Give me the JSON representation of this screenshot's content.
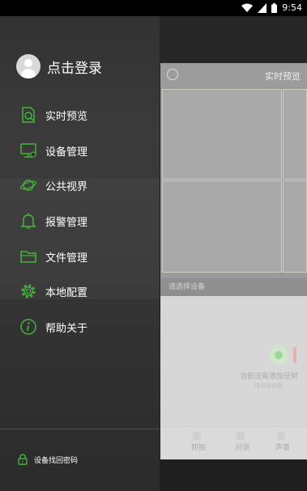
{
  "status_bar": {
    "time": "9:54",
    "icons": [
      "wifi-icon",
      "signal-icon",
      "battery-icon"
    ]
  },
  "drawer": {
    "login_label": "点击登录",
    "avatar_icon": "user-avatar-icon",
    "accent": "#46b33a",
    "menu": [
      {
        "label": "实时预览",
        "icon": "live-preview-icon"
      },
      {
        "label": "设备管理",
        "icon": "device-monitor-icon"
      },
      {
        "label": "公共视界",
        "icon": "planet-icon"
      },
      {
        "label": "报警管理",
        "icon": "bell-icon"
      },
      {
        "label": "文件管理",
        "icon": "folder-icon"
      },
      {
        "label": "本地配置",
        "icon": "gear-icon"
      },
      {
        "label": "帮助关于",
        "icon": "info-icon"
      }
    ],
    "footer_label": "设备找回密码",
    "footer_icon": "lock-icon"
  },
  "background_app": {
    "title": "实时预览",
    "channel_bar": "请选择设备",
    "empty_text": "当前没有添加任何",
    "empty_sub": "请添加设备",
    "toolbar": [
      "抓拍",
      "对讲",
      "声音"
    ]
  }
}
